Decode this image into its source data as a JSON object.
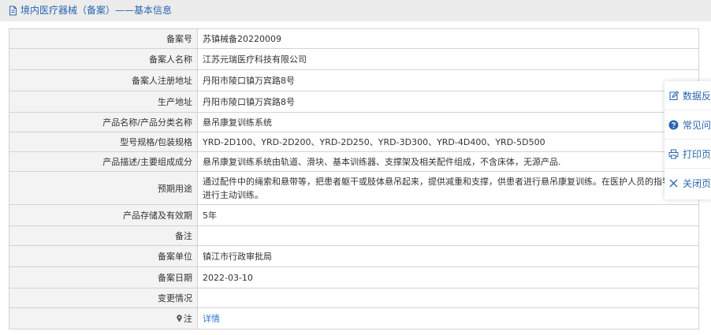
{
  "header": {
    "title": "境内医疗器械（备案）——基本信息",
    "icon": "document-icon",
    "color": "#2a66b0"
  },
  "rows": [
    {
      "label": "备案号",
      "value": "苏镇械备20220009"
    },
    {
      "label": "备案人名称",
      "value": "江苏元瑞医疗科技有限公司"
    },
    {
      "label": "备案人注册地址",
      "value": "丹阳市陵口镇万宾路8号"
    },
    {
      "label": "生产地址",
      "value": "丹阳市陵口镇万宾路8号"
    },
    {
      "label": "产品名称/产品分类名称",
      "value": "悬吊康复训练系统"
    },
    {
      "label": "型号规格/包装规格",
      "value": "YRD-2D100、YRD-2D200、YRD-2D250、YRD-3D300、YRD-4D400、YRD-5D500"
    },
    {
      "label": "产品描述/主要组成成分",
      "value": "悬吊康复训练系统由轨道、滑块、基本训练器、支撑架及相关配件组成，不含床体，无源产品."
    },
    {
      "label": "预期用途",
      "value": "通过配件中的绳索和悬带等，把患者躯干或肢体悬吊起来，提供减重和支撑，供患者进行悬吊康复训练。在医护人员的指导下，进行主动训练。"
    },
    {
      "label": "产品存储及有效期",
      "value": "5年"
    },
    {
      "label": "备注",
      "value": ""
    },
    {
      "label": "备案单位",
      "value": "镇江市行政审批局"
    },
    {
      "label": "备案日期",
      "value": "2022-03-10"
    },
    {
      "label": "变更情况",
      "value": ""
    },
    {
      "label": "注",
      "value": "详情",
      "icon": "pin-icon"
    }
  ],
  "sidebar": {
    "items": [
      {
        "label": "数据反",
        "icon": "edit-icon"
      },
      {
        "label": "常见问",
        "icon": "help-icon"
      },
      {
        "label": "打印页",
        "icon": "printer-icon"
      },
      {
        "label": "关闭页",
        "icon": "close-icon"
      }
    ]
  },
  "colors": {
    "accent": "#2a66b0",
    "link": "#2a7ad3",
    "label_bg": "#f3f3f3",
    "header_bg": "#ececec",
    "border": "#d3d3d3"
  }
}
